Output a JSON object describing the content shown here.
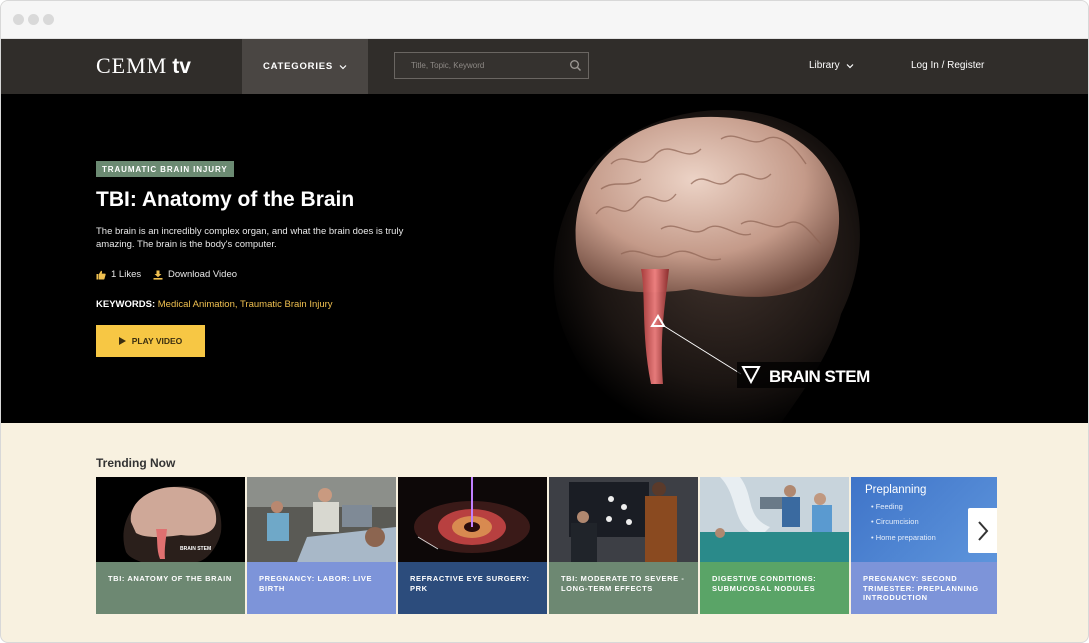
{
  "header": {
    "logo_main": "CEMM",
    "logo_sub": "tv",
    "categories_label": "CATEGORIES",
    "search_placeholder": "Title, Topic, Keyword",
    "library_label": "Library",
    "login_label": "Log In / Register"
  },
  "hero": {
    "tag": "TRAUMATIC BRAIN INJURY",
    "title": "TBI: Anatomy of the Brain",
    "description": "The brain is an incredibly complex organ, and what the brain does is truly amazing. The brain is the body's computer.",
    "likes": "1 Likes",
    "download": "Download Video",
    "keywords_label": "KEYWORDS:",
    "keywords": [
      "Medical Animation",
      "Traumatic Brain Injury"
    ],
    "play_label": "PLAY VIDEO",
    "image_label": "BRAIN STEM"
  },
  "trending": {
    "title": "Trending Now",
    "items": [
      {
        "label": "TBI: ANATOMY OF THE BRAIN",
        "color": "#6d8872",
        "thumb_text": "BRAIN STEM"
      },
      {
        "label": "PREGNANCY: LABOR: LIVE BIRTH",
        "color": "#7d94d9"
      },
      {
        "label": "REFRACTIVE EYE SURGERY: PRK",
        "color": "#2c4c7c"
      },
      {
        "label": "TBI: MODERATE TO SEVERE - LONG-TERM EFFECTS",
        "color": "#6d8872"
      },
      {
        "label": "DIGESTIVE CONDITIONS: SUBMUCOSAL NODULES",
        "color": "#5aa467"
      },
      {
        "label": "PREGNANCY: SECOND TRIMESTER: PREPLANNING INTRODUCTION",
        "color": "#7d94d9",
        "thumb_title": "Preplanning",
        "thumb_items": [
          "Feeding",
          "Circumcision",
          "Home preparation"
        ]
      }
    ]
  },
  "colors": {
    "accent": "#f7c744",
    "nav_bg": "#302d2a",
    "page_bg": "#f8f1e0",
    "tag_bg": "#6b8a72",
    "keyword_link": "#f0c050"
  }
}
